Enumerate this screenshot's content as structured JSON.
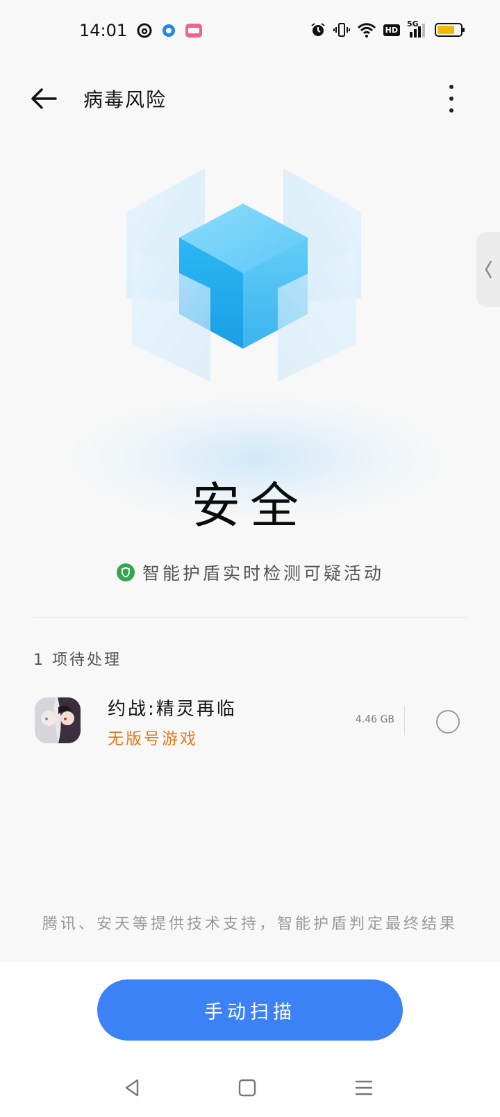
{
  "status_bar": {
    "time": "14:01",
    "left_icons": [
      "netease-music-icon",
      "blue-dot-app-icon",
      "bilibili-icon"
    ],
    "right_icons": [
      "alarm-icon",
      "vibrate-icon",
      "wifi-icon",
      "hd-icon",
      "signal-5g-icon",
      "battery-icon"
    ],
    "hd_label": "HD",
    "network_label": "5G"
  },
  "header": {
    "title": "病毒风险"
  },
  "hero": {
    "status": "安全",
    "shield_text": "智能护盾实时检测可疑活动"
  },
  "pending": {
    "label": "1 项待处理",
    "items": [
      {
        "name": "约战:精灵再临",
        "tag": "无版号游戏",
        "size": "4.46 GB"
      }
    ]
  },
  "footer_note": "腾讯、安天等提供技术支持，智能护盾判定最终结果",
  "actions": {
    "scan_label": "手动扫描"
  },
  "colors": {
    "accent": "#3b82f6",
    "warning": "#e07a1a",
    "shield_green": "#2fa84f",
    "cube_blue": "#29b6f6"
  }
}
